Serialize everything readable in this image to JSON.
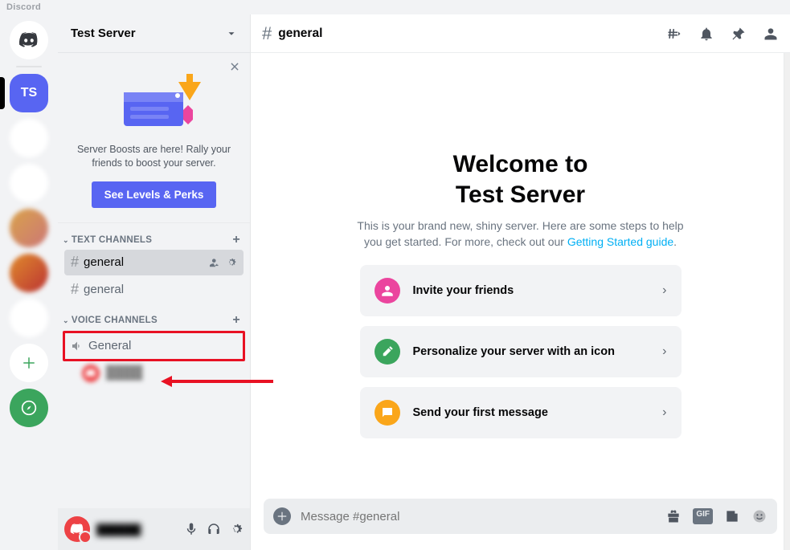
{
  "titlebar": "Discord",
  "server": {
    "name": "Test Server",
    "initials": "TS"
  },
  "banner": {
    "line1": "Server Boosts are here! Rally your",
    "line2": "friends to boost your server.",
    "button": "See Levels & Perks"
  },
  "sections": {
    "text_label": "TEXT CHANNELS",
    "voice_label": "VOICE CHANNELS"
  },
  "text_channels": [
    {
      "name": "general",
      "active": true
    },
    {
      "name": "general",
      "active": false
    }
  ],
  "voice_channels": [
    {
      "name": "General"
    }
  ],
  "header": {
    "channel_name": "general"
  },
  "welcome": {
    "title_line1": "Welcome to",
    "title_line2": "Test Server",
    "subtitle_prefix": "This is your brand new, shiny server. Here are some steps to help you get started. For more, check out our ",
    "subtitle_link": "Getting Started guide",
    "subtitle_suffix": "."
  },
  "cards": [
    {
      "label": "Invite your friends",
      "icon_color": "#EB459E"
    },
    {
      "label": "Personalize your server with an icon",
      "icon_color": "#3BA55D"
    },
    {
      "label": "Send your first message",
      "icon_color": "#FAA61A"
    }
  ],
  "composer": {
    "placeholder": "Message #general"
  }
}
